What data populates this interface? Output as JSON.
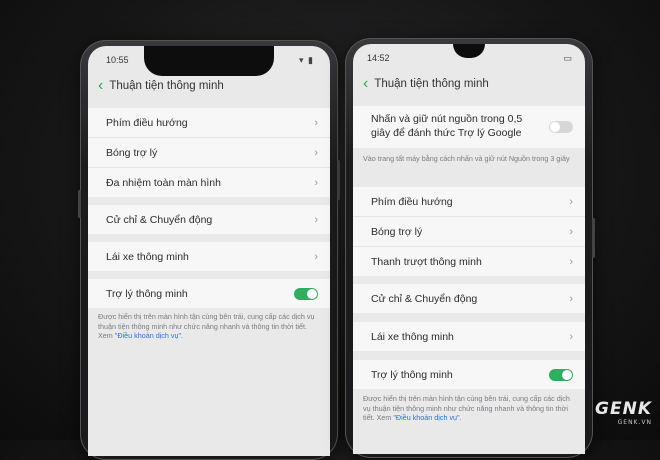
{
  "left_phone": {
    "status_time": "10:55",
    "header_title": "Thuận tiện thông minh",
    "menu_group_1": [
      "Phím điều hướng",
      "Bóng trợ lý",
      "Đa nhiệm toàn màn hình"
    ],
    "row_gestures": "Cử chỉ & Chuyển động",
    "row_driving": "Lái xe thông minh",
    "row_assistant": "Trợ lý thông minh",
    "assistant_toggle_on": true,
    "note_text": "Được hiển thị trên màn hình tận cùng bên trái, cung cấp các dịch vụ thuận tiện thông minh như chức năng nhanh và thông tin thời tiết. Xem ",
    "note_link": "\"Điều khoản dịch vụ\"."
  },
  "right_phone": {
    "status_time": "14:52",
    "header_title": "Thuận tiện thông minh",
    "google_row_label": "Nhấn và giữ nút nguồn trong 0,5 giây để đánh thức Trợ lý Google",
    "google_toggle_on": false,
    "google_note": "Vào trang tất máy bằng cách nhấn và giữ nút Nguồn trong 3 giây",
    "menu_group_1": [
      "Phím điều hướng",
      "Bóng trợ lý",
      "Thanh trượt thông minh"
    ],
    "row_gestures": "Cử chỉ & Chuyển động",
    "row_driving": "Lái xe thông minh",
    "row_assistant": "Trợ lý thông minh",
    "assistant_toggle_on": true,
    "note_text": "Được hiển thị trên màn hình tận cùng bên trái, cung cấp các dịch vụ thuận tiện thông minh như chức năng nhanh và thông tin thời tiết. Xem ",
    "note_link": "\"Điều khoản dịch vụ\"."
  },
  "watermark": {
    "logo": "GENK",
    "site": "GENK.VN"
  },
  "colors": {
    "accent_green": "#2fae60",
    "link_blue": "#2f6fd6",
    "screen_bg": "#e9e9ea"
  }
}
